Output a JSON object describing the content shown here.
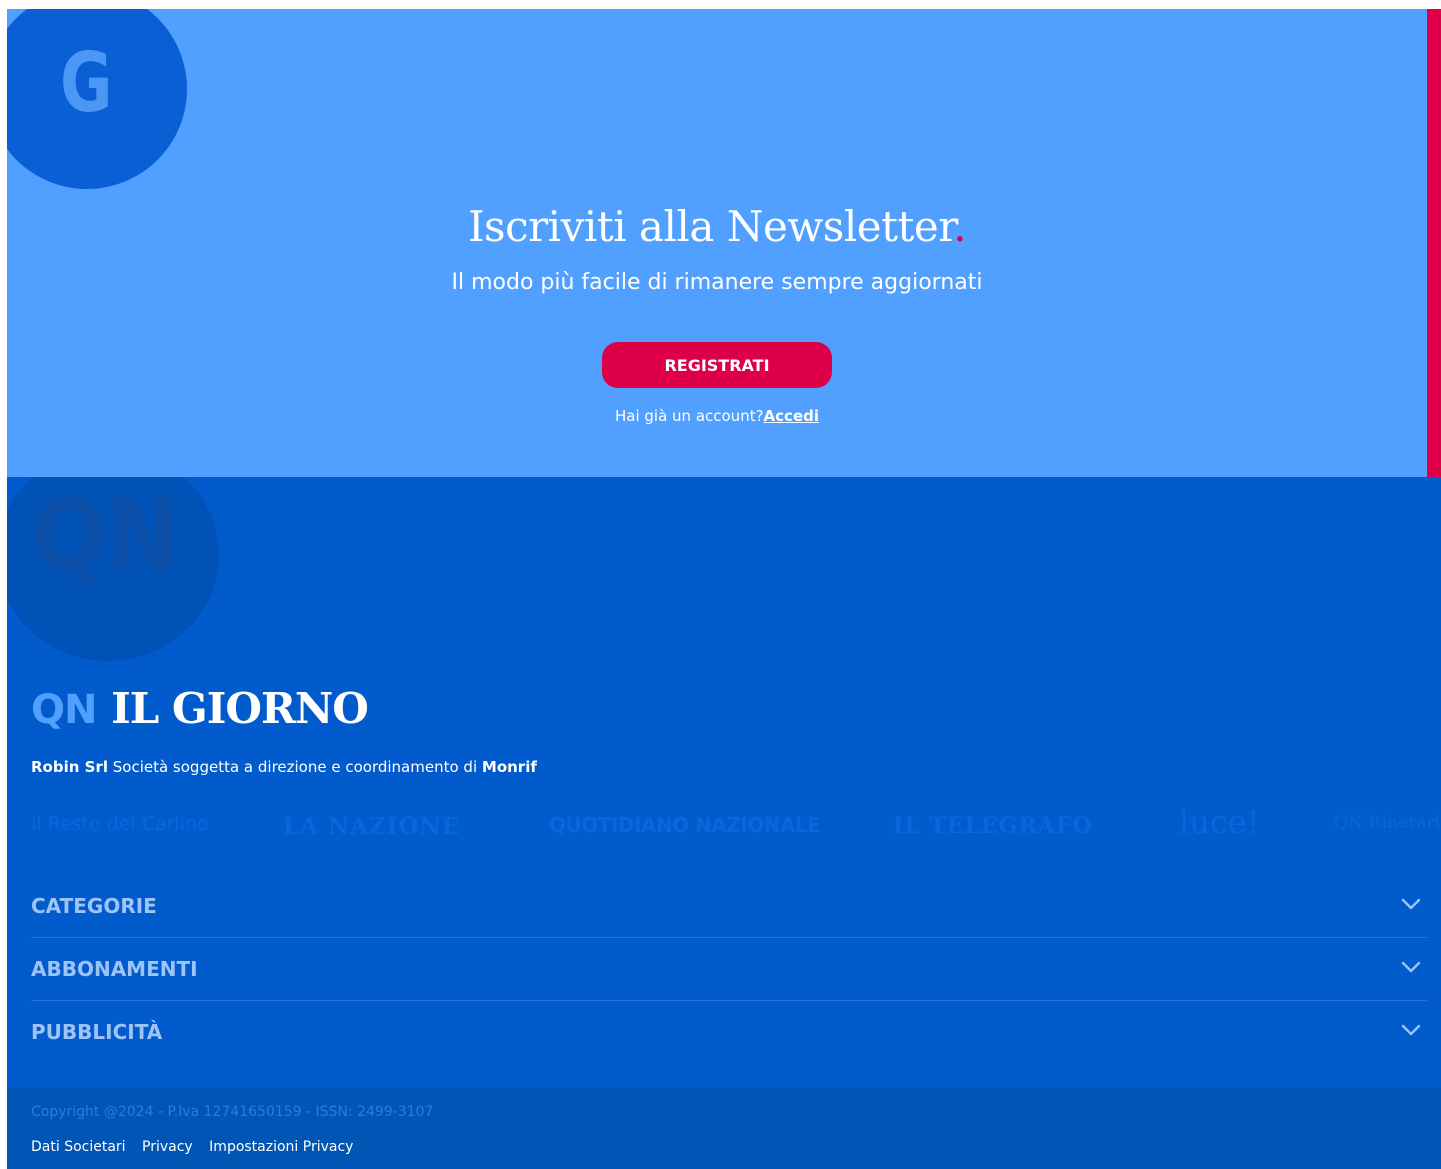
{
  "newsletter": {
    "badge_letter": "G",
    "title": "Iscriviti alla Newsletter",
    "title_dot": ".",
    "subtitle": "Il modo più facile di rimanere sempre aggiornati",
    "register_label": "REGISTRATI",
    "login_prompt": "Hai già un account?",
    "login_link": "Accedi"
  },
  "footer": {
    "badge_letters": "QN",
    "brand_prefix": "QN",
    "brand_name": "IL GIORNO",
    "company_name": "Robin Srl",
    "company_text": " Società soggetta a direzione e coordinamento di ",
    "parent_company": "Monrif",
    "partners": [
      "il Resto del Carlino",
      "LA NAZIONE",
      "QUOTIDIANO NAZIONALE",
      "IL TELEGRAFO",
      "luce!",
      "QN Itinerari"
    ],
    "sections": [
      {
        "label": "CATEGORIE"
      },
      {
        "label": "ABBONAMENTI"
      },
      {
        "label": "PUBBLICITÀ"
      }
    ],
    "copyright": "Copyright @2024 - P.Iva 12741650159 - ISSN: 2499-3107",
    "legal_links": [
      "Dati Societari",
      "Privacy",
      "Impostazioni Privacy"
    ]
  },
  "colors": {
    "newsletter_bg": "#519ffe",
    "accent_red": "#dd0049",
    "footer_bg": "#015bcc",
    "bottom_bar_bg": "#0055b5"
  },
  "icons": {
    "accordion_toggle": "chevron-down-icon"
  }
}
